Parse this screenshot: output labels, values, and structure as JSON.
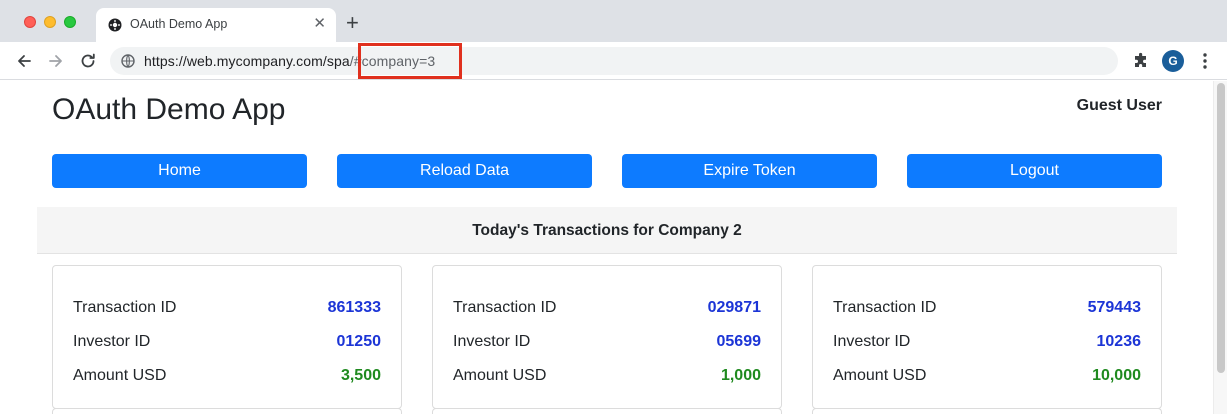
{
  "browser": {
    "tab_title": "OAuth Demo App",
    "tab_close": "✕",
    "new_tab": "+",
    "url_base": "https://web.mycompany.com/spa",
    "url_hash": "/#company=3",
    "profile_initial": "G"
  },
  "app": {
    "title": "OAuth Demo App",
    "user": "Guest User"
  },
  "nav": {
    "home": "Home",
    "reload": "Reload Data",
    "expire": "Expire Token",
    "logout": "Logout"
  },
  "section": {
    "title": "Today's Transactions for Company 2"
  },
  "transactions": [
    {
      "labels": {
        "transaction_id": "Transaction ID",
        "investor_id": "Investor ID",
        "amount": "Amount USD"
      },
      "transaction_id": "861333",
      "investor_id": "01250",
      "amount": "3,500"
    },
    {
      "labels": {
        "transaction_id": "Transaction ID",
        "investor_id": "Investor ID",
        "amount": "Amount USD"
      },
      "transaction_id": "029871",
      "investor_id": "05699",
      "amount": "1,000"
    },
    {
      "labels": {
        "transaction_id": "Transaction ID",
        "investor_id": "Investor ID",
        "amount": "Amount USD"
      },
      "transaction_id": "579443",
      "investor_id": "10236",
      "amount": "10,000"
    }
  ],
  "colors": {
    "primary_button": "#0d7bff",
    "id_value": "#1c35d6",
    "amount_value": "#1f8a1f",
    "url_highlight": "#e0301e"
  }
}
